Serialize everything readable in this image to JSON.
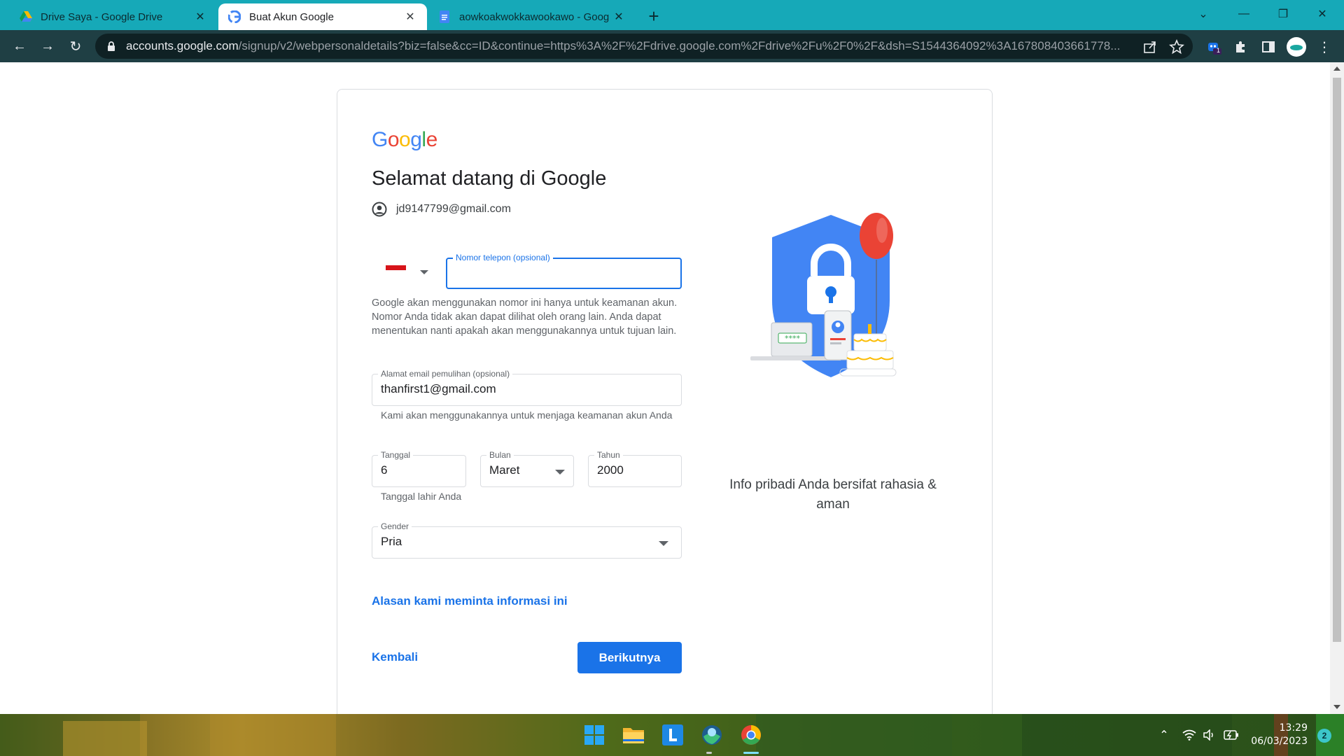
{
  "browser": {
    "tabs": [
      {
        "title": "Drive Saya - Google Drive",
        "icon": "google-drive-icon",
        "active": false
      },
      {
        "title": "Buat Akun Google",
        "icon": "google-g-icon",
        "active": true
      },
      {
        "title": "aowkoakwokkawookawo - Goog",
        "icon": "google-docs-icon",
        "active": false
      }
    ],
    "url_host": "accounts.google.com",
    "url_path": "/signup/v2/webpersonaldetails?biz=false&cc=ID&continue=https%3A%2F%2Fdrive.google.com%2Fdrive%2Fu%2F0%2F&dsh=S1544364092%3A167808403661778...",
    "extension_badge": "1"
  },
  "page": {
    "logo": "Google",
    "title": "Selamat datang di Google",
    "account_email": "jd9147799@gmail.com",
    "phone": {
      "label": "Nomor telepon (opsional)",
      "value": "",
      "country": "Indonesia",
      "help": "Google akan menggunakan nomor ini hanya untuk keamanan akun. Nomor Anda tidak akan dapat dilihat oleh orang lain. Anda dapat menentukan nanti apakah akan menggunakannya untuk tujuan lain."
    },
    "recovery_email": {
      "label": "Alamat email pemulihan (opsional)",
      "value": "thanfirst1@gmail.com",
      "help": "Kami akan menggunakannya untuk menjaga keamanan akun Anda"
    },
    "birthdate": {
      "day_label": "Tanggal",
      "day_value": "6",
      "month_label": "Bulan",
      "month_value": "Maret",
      "year_label": "Tahun",
      "year_value": "2000",
      "help": "Tanggal lahir Anda"
    },
    "gender": {
      "label": "Gender",
      "value": "Pria"
    },
    "why_link": "Alasan kami meminta informasi ini",
    "back_label": "Kembali",
    "next_label": "Berikutnya",
    "illustration_caption": "Info pribadi Anda bersifat rahasia & aman",
    "colors": {
      "accent": "#1a73e8",
      "shield": "#4285f4",
      "balloon": "#ea4335",
      "tabstrip": "#16a9b8"
    }
  },
  "taskbar": {
    "apps": [
      "windows-start-icon",
      "file-explorer-icon",
      "l-app-icon",
      "edge-like-icon",
      "chrome-icon"
    ],
    "time": "13:29",
    "date": "06/03/2023",
    "notifications": "2"
  }
}
